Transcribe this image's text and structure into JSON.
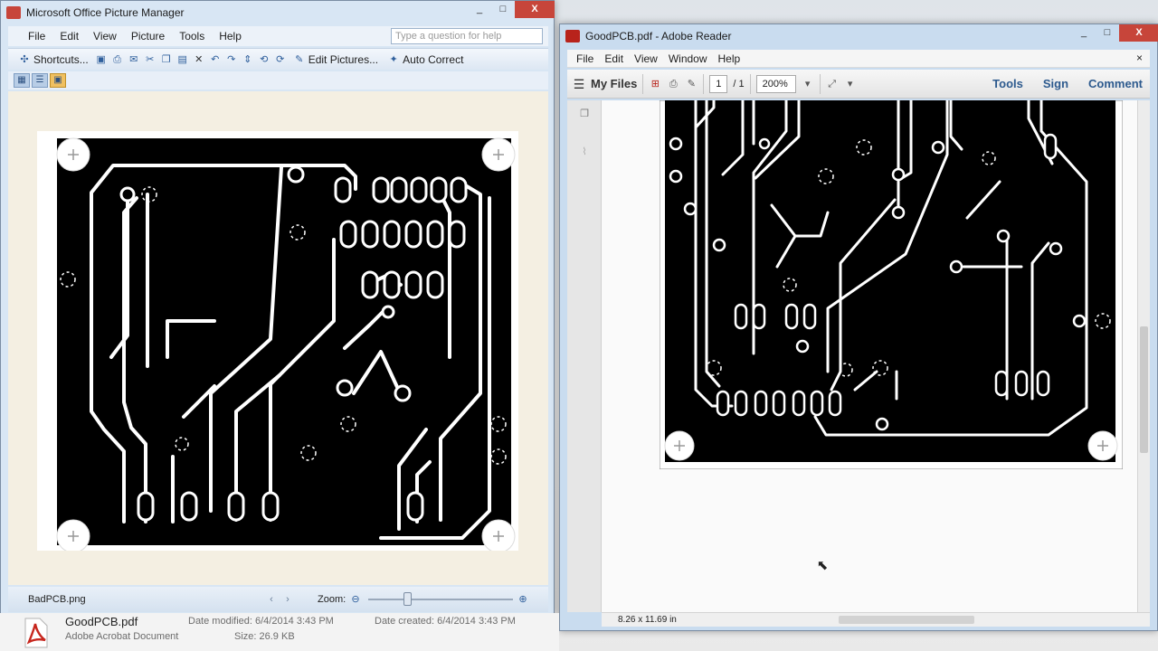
{
  "picture_manager": {
    "title": "Microsoft Office Picture Manager",
    "menu": [
      "File",
      "Edit",
      "View",
      "Picture",
      "Tools",
      "Help"
    ],
    "help_placeholder": "Type a question for help",
    "toolbar": {
      "shortcuts": "Shortcuts...",
      "edit_pictures": "Edit Pictures...",
      "auto_correct": "Auto Correct"
    },
    "filename": "BadPCB.png",
    "zoom_label": "Zoom:",
    "window_controls": [
      "_",
      "□",
      "X"
    ]
  },
  "adobe_reader": {
    "title": "GoodPCB.pdf - Adobe Reader",
    "menu": [
      "File",
      "Edit",
      "View",
      "Window",
      "Help"
    ],
    "close_doc": "×",
    "toolbar": {
      "my_files": "My Files",
      "page_current": "1",
      "page_total": "/ 1",
      "zoom": "200%",
      "tools": "Tools",
      "sign": "Sign",
      "comment": "Comment"
    },
    "page_size": "8.26 x 11.69 in",
    "window_controls": [
      "_",
      "□",
      "X"
    ]
  },
  "explorer": {
    "file_name": "GoodPCB.pdf",
    "file_type": "Adobe Acrobat Document",
    "date_modified": "Date modified: 6/4/2014 3:43 PM",
    "date_created": "Date created: 6/4/2014 3:43 PM",
    "size": "Size: 26.9 KB"
  },
  "colors": {
    "accent": "#c7453a",
    "pcb": "#000000",
    "trace": "#ffffff"
  }
}
